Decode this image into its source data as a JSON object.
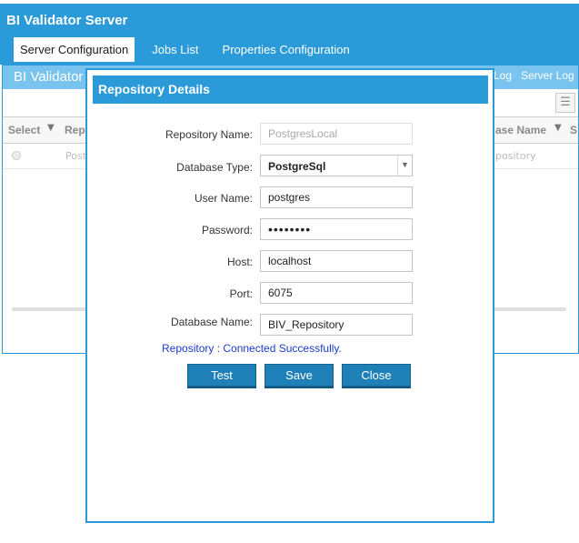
{
  "app": {
    "title": "BI Validator Server",
    "tabs": [
      {
        "label": "Server Configuration",
        "active": true
      },
      {
        "label": "Jobs List",
        "active": false
      },
      {
        "label": "Properties Configuration",
        "active": false
      }
    ],
    "accent_color": "#2b9ad9"
  },
  "background_panel": {
    "subtitle": "BI Validator",
    "links": [
      "Log",
      "Server Log"
    ],
    "grid": {
      "columns": [
        "Select",
        "Repo",
        "ase Name",
        "S"
      ],
      "row": {
        "col1": "Post",
        "col3": "pository"
      }
    }
  },
  "dialog": {
    "title": "Repository Details",
    "fields": {
      "repository_name": {
        "label": "Repository Name:",
        "value": "PostgresLocal"
      },
      "database_type": {
        "label": "Database Type:",
        "value": "PostgreSql"
      },
      "user_name": {
        "label": "User Name:",
        "value": "postgres"
      },
      "password": {
        "label": "Password:",
        "value": "••••••••"
      },
      "host": {
        "label": "Host:",
        "value": "localhost"
      },
      "port": {
        "label": "Port:",
        "value": "6075"
      },
      "database_name": {
        "label": "Database Name:",
        "value": "BIV_Repository"
      }
    },
    "status_message": "Repository : Connected Successfully.",
    "buttons": {
      "test": "Test",
      "save": "Save",
      "close": "Close"
    }
  }
}
